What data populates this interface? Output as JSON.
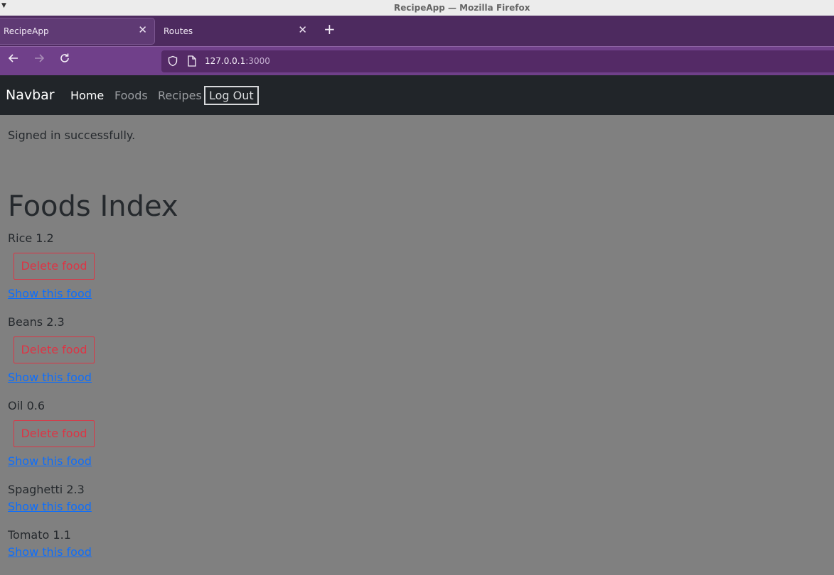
{
  "window": {
    "title": "RecipeApp — Mozilla Firefox"
  },
  "tabs": [
    {
      "label": "RecipeApp",
      "active": true
    },
    {
      "label": "Routes",
      "active": false
    }
  ],
  "toolbar": {
    "url_host": "127.0.0.1",
    "url_port": ":3000"
  },
  "navbar": {
    "brand": "Navbar",
    "links": {
      "home": "Home",
      "foods": "Foods",
      "recipes": "Recipes",
      "logout": "Log Out"
    }
  },
  "main": {
    "notice": "Signed in successfully.",
    "title": "Foods Index",
    "foods": [
      {
        "name": "Rice 1.2",
        "delete_label": "Delete food",
        "show_label": "Show this food"
      },
      {
        "name": "Beans 2.3",
        "delete_label": "Delete food",
        "show_label": "Show this food"
      },
      {
        "name": "Oil 0.6",
        "delete_label": "Delete food",
        "show_label": "Show this food"
      },
      {
        "name": "Spaghetti 2.3",
        "show_label": "Show this food"
      },
      {
        "name": "Tomato 1.1",
        "show_label": "Show this food"
      }
    ]
  },
  "colors": {
    "tab_strip": "#4d2a5f",
    "toolbar": "#70408a",
    "navbar": "#212529",
    "page_bg": "#808080",
    "danger": "#dc3545",
    "link": "#0d6efd"
  },
  "icons": [
    "menu-caret-icon",
    "close-icon",
    "plus-icon",
    "back-arrow-icon",
    "forward-arrow-icon",
    "reload-icon",
    "shield-icon",
    "page-icon"
  ]
}
